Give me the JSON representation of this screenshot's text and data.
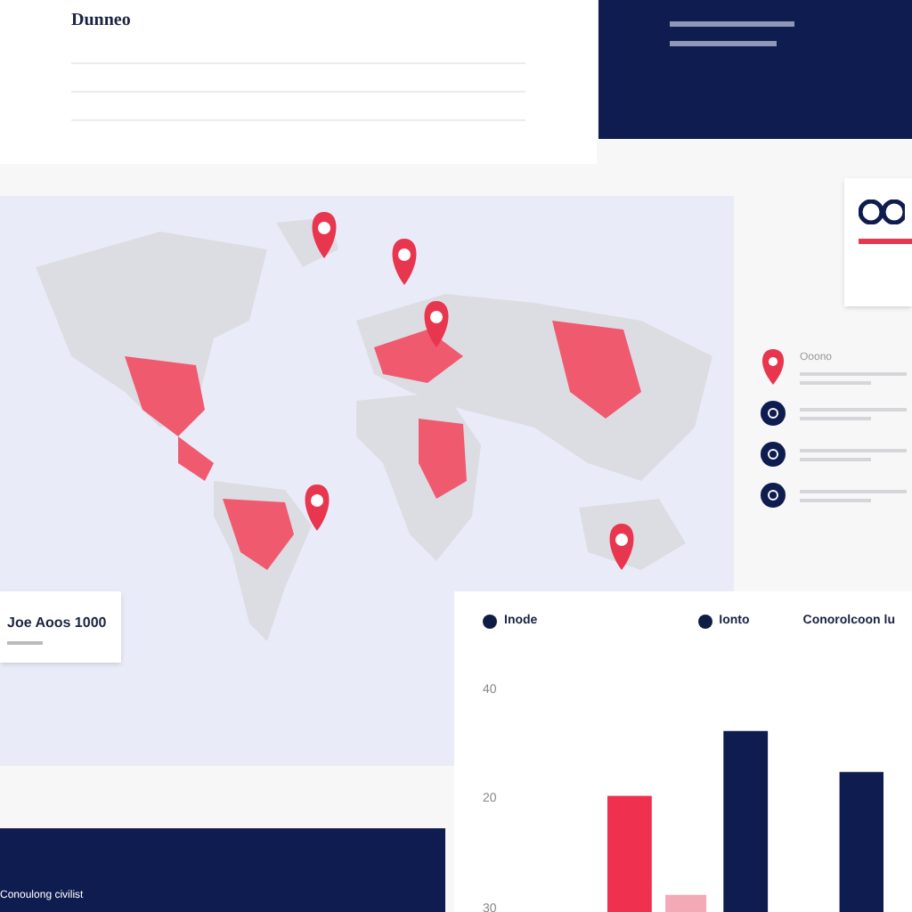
{
  "header": {
    "title": "Dunneo"
  },
  "map_card": {
    "title": "Joe Aoos 1000"
  },
  "side_list": [
    {
      "kind": "pin",
      "label": "Ooono"
    },
    {
      "kind": "circle"
    },
    {
      "kind": "circle"
    },
    {
      "kind": "circle"
    }
  ],
  "chart": {
    "legend": [
      {
        "label": "Inode",
        "color": "#0f1d45"
      },
      {
        "label": "Ionto",
        "color": "#0f1d45"
      }
    ],
    "caption": "Conorolcoon lu",
    "y_labels": [
      "40",
      "20",
      "30"
    ]
  },
  "footer": {
    "text": "Conoulong civilist"
  }
}
